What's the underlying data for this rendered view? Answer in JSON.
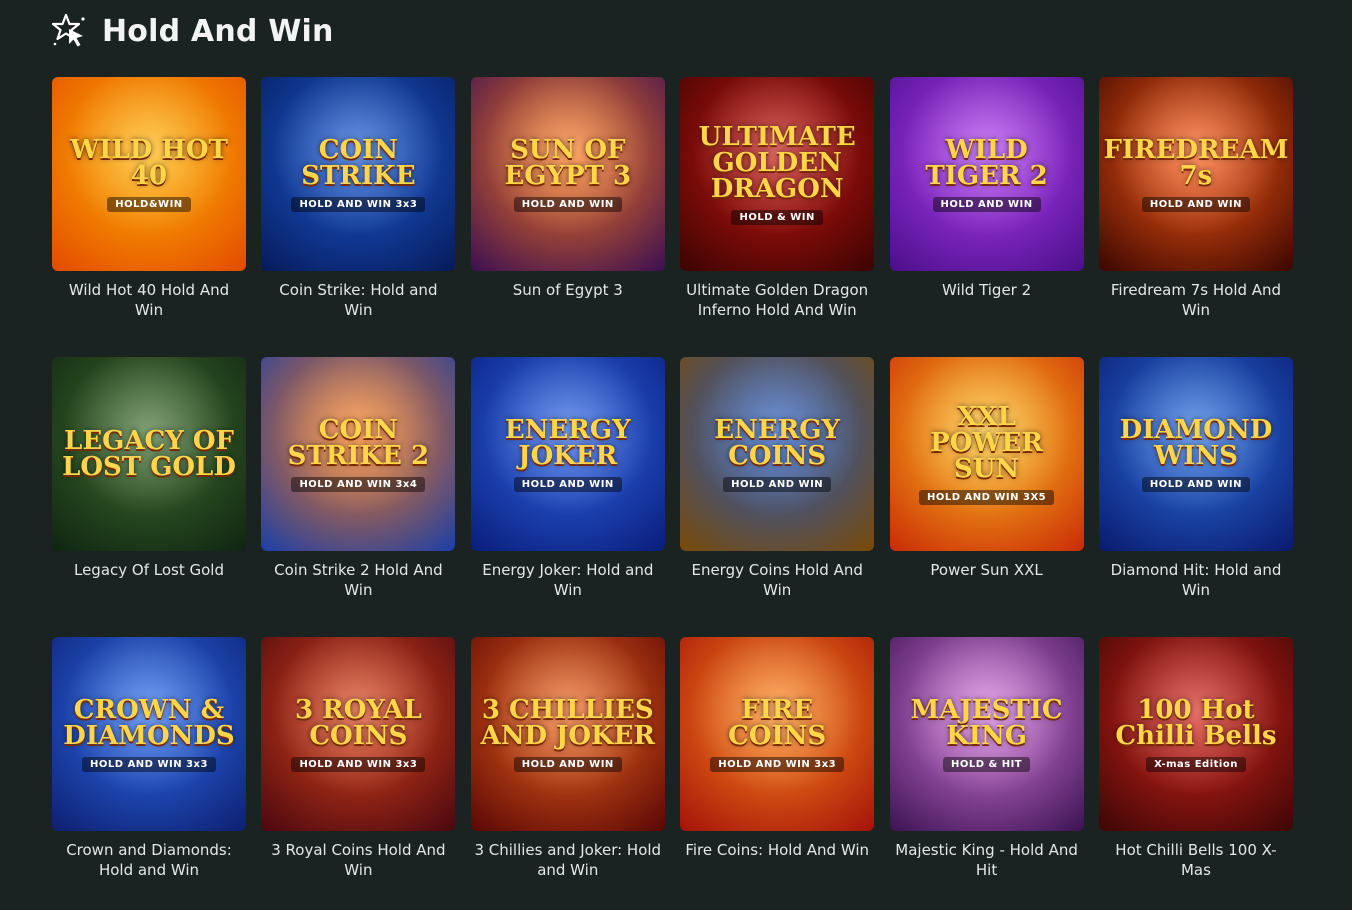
{
  "section": {
    "title": "Hold And Win",
    "icon": "star-cursor-icon"
  },
  "games": [
    {
      "title": "Wild Hot 40 Hold And Win",
      "art_main": "WILD HOT 40",
      "art_sub": "HOLD&WIN",
      "bg": [
        "#ffb400",
        "#e34a00"
      ]
    },
    {
      "title": "Coin Strike: Hold and Win",
      "art_main": "COIN STRIKE",
      "art_sub": "HOLD AND WIN 3x3",
      "bg": [
        "#1b5dd6",
        "#071a5a"
      ]
    },
    {
      "title": "Sun of Egypt 3",
      "art_main": "SUN OF EGYPT 3",
      "art_sub": "HOLD AND WIN",
      "bg": [
        "#ff7a1a",
        "#3a0f52"
      ]
    },
    {
      "title": "Ultimate Golden Dragon Inferno Hold And Win",
      "art_main": "ULTIMATE GOLDEN DRAGON",
      "art_sub": "HOLD & WIN",
      "bg": [
        "#c8140e",
        "#3b0403"
      ]
    },
    {
      "title": "Wild Tiger 2",
      "art_main": "WILD TIGER 2",
      "art_sub": "HOLD AND WIN",
      "bg": [
        "#b13cf0",
        "#4a0f8a"
      ]
    },
    {
      "title": "Firedream 7s Hold And Win",
      "art_main": "FIREDREAM 7s",
      "art_sub": "HOLD AND WIN",
      "bg": [
        "#ff5a12",
        "#3a0602"
      ]
    },
    {
      "title": "Legacy Of Lost Gold",
      "art_main": "LEGACY OF LOST GOLD",
      "art_sub": "",
      "bg": [
        "#3f6d2c",
        "#0f2512"
      ]
    },
    {
      "title": "Coin Strike 2 Hold And Win",
      "art_main": "COIN STRIKE 2",
      "art_sub": "HOLD AND WIN 3x4",
      "bg": [
        "#ff7b12",
        "#1a3ea8"
      ]
    },
    {
      "title": "Energy Joker: Hold and Win",
      "art_main": "ENERGY JOKER",
      "art_sub": "HOLD AND WIN",
      "bg": [
        "#2d66e8",
        "#0a1d7a"
      ]
    },
    {
      "title": "Energy Coins Hold And Win",
      "art_main": "ENERGY COINS",
      "art_sub": "HOLD AND WIN",
      "bg": [
        "#1f5ac8",
        "#7a4a06"
      ]
    },
    {
      "title": "Power Sun XXL",
      "art_main": "XXL POWER SUN",
      "art_sub": "HOLD AND WIN 3X5",
      "bg": [
        "#ffc320",
        "#c92a06"
      ]
    },
    {
      "title": "Diamond Hit: Hold and Win",
      "art_main": "DIAMOND WINS",
      "art_sub": "HOLD AND WIN",
      "bg": [
        "#2a70e0",
        "#0a1a6e"
      ]
    },
    {
      "title": "Crown and Diamonds: Hold and Win",
      "art_main": "CROWN & DIAMONDS",
      "art_sub": "HOLD AND WIN 3x3",
      "bg": [
        "#2c6ef0",
        "#0e1f70"
      ]
    },
    {
      "title": "3 Royal Coins Hold And Win",
      "art_main": "3 ROYAL COINS",
      "art_sub": "HOLD AND WIN 3x3",
      "bg": [
        "#e0451a",
        "#4a0710"
      ]
    },
    {
      "title": "3 Chillies and Joker: Hold and Win",
      "art_main": "3 CHILLIES AND JOKER",
      "art_sub": "HOLD AND WIN",
      "bg": [
        "#f0661c",
        "#5a0606"
      ]
    },
    {
      "title": "Fire Coins: Hold And Win",
      "art_main": "FIRE COINS",
      "art_sub": "HOLD AND WIN 3x3",
      "bg": [
        "#ff8a1a",
        "#a3120a"
      ]
    },
    {
      "title": "Majestic King - Hold And Hit",
      "art_main": "MAJESTIC KING",
      "art_sub": "HOLD & HIT",
      "bg": [
        "#d87adf",
        "#3b1352"
      ]
    },
    {
      "title": "Hot Chilli Bells 100 X-Mas",
      "art_main": "100 Hot Chilli Bells",
      "art_sub": "X-mas Edition",
      "bg": [
        "#d8241a",
        "#3c0606"
      ]
    }
  ]
}
